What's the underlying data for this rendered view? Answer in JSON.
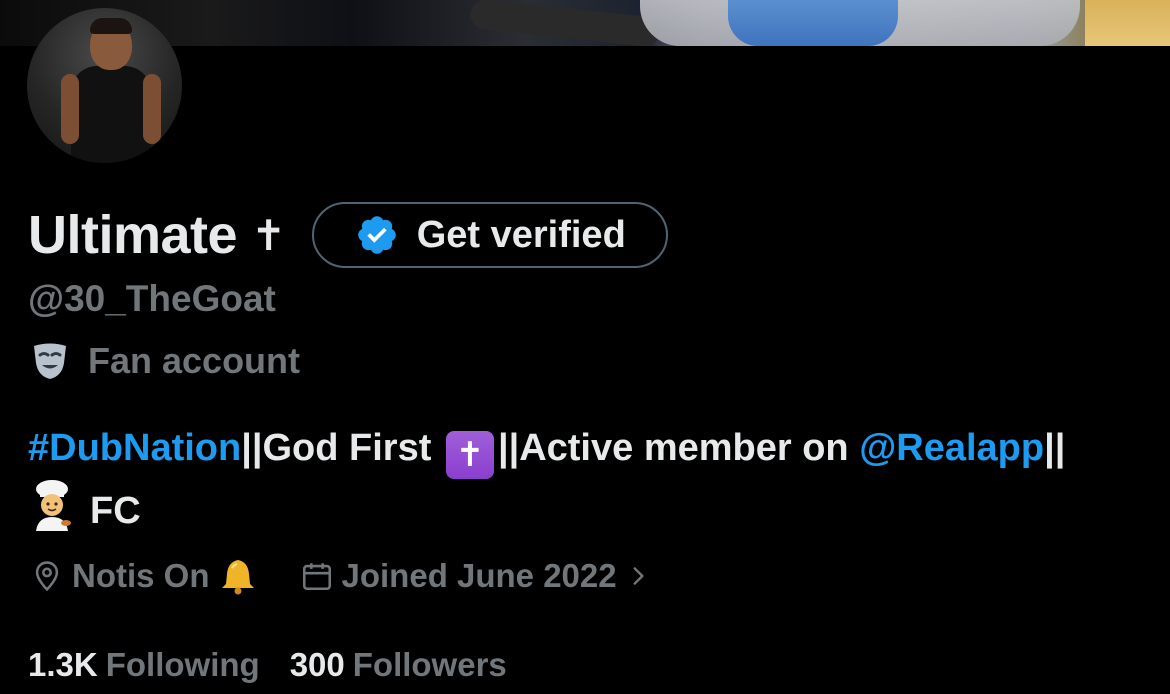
{
  "profile": {
    "display_name": "Ultimate",
    "name_symbol": "✝",
    "get_verified_label": "Get verified",
    "handle": "@30_TheGoat",
    "category_label": "Fan account",
    "category_icon": "theater-mask-icon"
  },
  "bio": {
    "hashtag": "#DubNation",
    "part1": "||God First ",
    "cross_emoji": "✝",
    "part2": "||Active member on ",
    "mention": "@Realapp",
    "part3": "||",
    "chef_emoji": "cook-emoji",
    "part4": "FC"
  },
  "meta": {
    "location_icon": "location-pin-icon",
    "location": "Notis On",
    "location_emoji": "bell-emoji",
    "calendar_icon": "calendar-icon",
    "joined": "Joined June 2022",
    "chevron_icon": "chevron-right-icon"
  },
  "stats": {
    "following_count": "1.3K",
    "following_label": "Following",
    "followers_count": "300",
    "followers_label": "Followers"
  },
  "colors": {
    "background": "#000000",
    "text_primary": "#e7e9ea",
    "text_secondary": "#71767b",
    "link": "#1d9bf0",
    "button_border": "#536471"
  }
}
